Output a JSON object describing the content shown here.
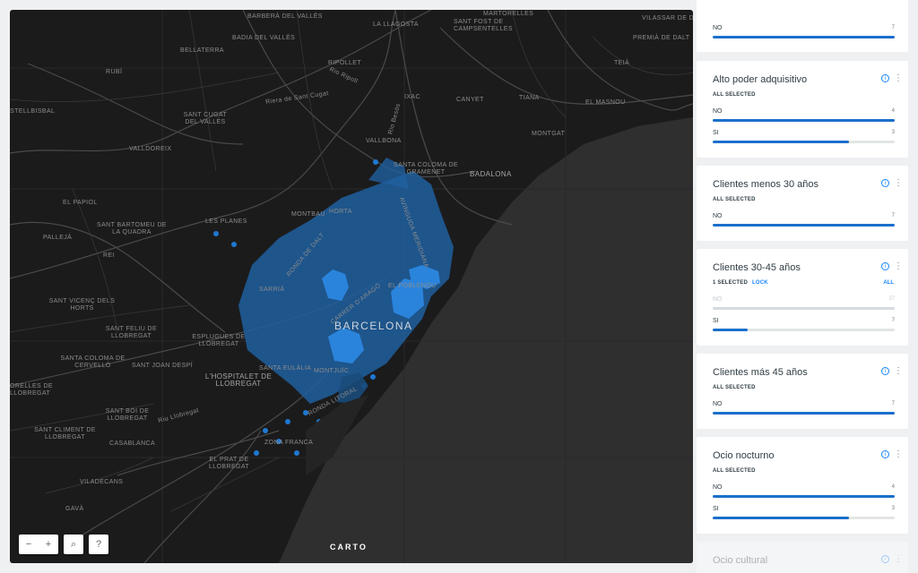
{
  "map": {
    "city_label": "BARCELONA",
    "labels": [
      "BARBERÀ DEL VALLÈS",
      "BADIA DEL VALLÈS",
      "BELLATERRA",
      "RUBÍ",
      "RIPOLLET",
      "LA LLAGOSTA",
      "SANT FOST DE CAMPSENTELLES",
      "MARTORELLES",
      "VILASSAR DE DALT",
      "PREMIÀ DE DALT",
      "TEIÀ",
      "STELLBISBAL",
      "SANT CUGAT DEL VALLÈS",
      "IXAC",
      "CANYET",
      "TIANA",
      "EL MASNOU",
      "MONTGAT",
      "VALLDOREIX",
      "VALLBONA",
      "SANTA COLOMA DE GRAMENET",
      "BADALONA",
      "EL PAPIOL",
      "MONTBAU",
      "HORTA",
      "SANT BARTOMEU DE LA QUADRA",
      "LES PLANES",
      "PALLEJÀ",
      "REI",
      "SARRIÀ",
      "EL POBLENOU",
      "SANT VICENÇ DELS HORTS",
      "SANT FELIU DE LLOBREGAT",
      "ESPLUGUES DE LLOBREGAT",
      "SANTA COLOMA DE CERVELLÓ",
      "SANT JOAN DESPÍ",
      "L'HOSPITALET DE LLOBREGAT",
      "SANTA EULÀLIA",
      "MONTJUÏC",
      "ORELLES DE LLOBREGAT",
      "SANT BOI DE LLOBREGAT",
      "SANT CLIMENT DE LLOBREGAT",
      "CASABLANCA",
      "ZONA FRANCA",
      "EL PRAT DE LLOBREGAT",
      "VILADECANS",
      "GAVÀ",
      "RONDA DE DALT",
      "CARRER D'ARAGÓ",
      "AVINGUDA MERIDIANA",
      "RONDA LITORAL",
      "Riera de Sant Cugat",
      "Rio Ripoll",
      "Rio Besòs",
      "Riu Llobregat"
    ],
    "controls": {
      "zoom_out": "−",
      "zoom_in": "+",
      "search": "⌕",
      "help": "?"
    },
    "attribution": "CARTO"
  },
  "colors": {
    "accent": "#1785fb",
    "bar": "#1b6fcb",
    "hex": "#1f78d2"
  },
  "widgets": [
    {
      "title": "",
      "status": "",
      "rows": [
        {
          "name": "NO",
          "count": "7",
          "fill": 1.0
        }
      ]
    },
    {
      "title": "Alto poder adquisitivo",
      "status": "ALL SELECTED",
      "rows": [
        {
          "name": "NO",
          "count": "4",
          "fill": 1.0
        },
        {
          "name": "SI",
          "count": "3",
          "fill": 0.75
        }
      ]
    },
    {
      "title": "Clientes menos 30 años",
      "status": "ALL SELECTED",
      "rows": [
        {
          "name": "NO",
          "count": "7",
          "fill": 1.0
        }
      ]
    },
    {
      "title": "Clientes 30-45 años",
      "status": "1 SELECTED",
      "lock": "LOCK",
      "all": "ALL",
      "rows": [
        {
          "name": "NO",
          "count": "37",
          "fill": 1.0,
          "disabled": true
        },
        {
          "name": "SI",
          "count": "7",
          "fill": 0.19
        }
      ]
    },
    {
      "title": "Clientes más 45 años",
      "status": "ALL SELECTED",
      "rows": [
        {
          "name": "NO",
          "count": "7",
          "fill": 1.0
        }
      ]
    },
    {
      "title": "Ocio nocturno",
      "status": "ALL SELECTED",
      "rows": [
        {
          "name": "NO",
          "count": "4",
          "fill": 1.0
        },
        {
          "name": "SI",
          "count": "3",
          "fill": 0.75
        }
      ]
    },
    {
      "title": "Ocio cultural",
      "status": "",
      "rows": []
    }
  ]
}
